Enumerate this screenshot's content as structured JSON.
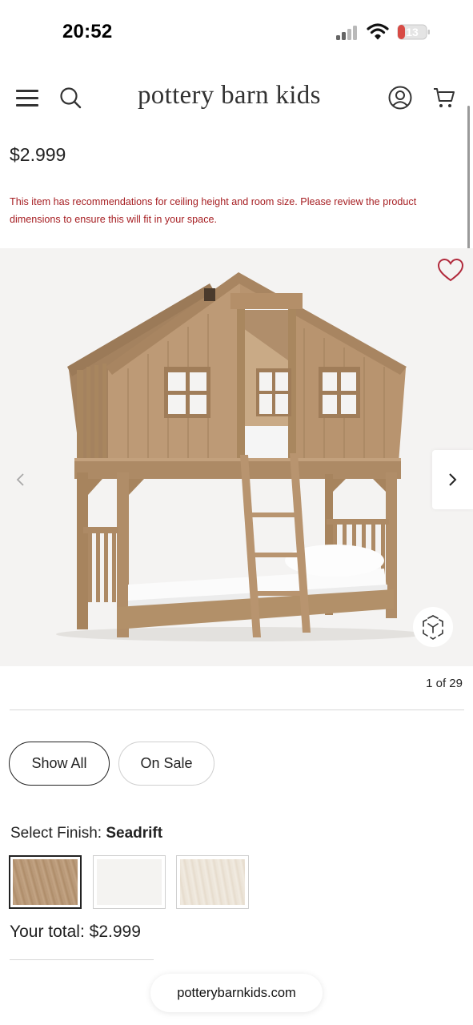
{
  "status_bar": {
    "time": "20:52",
    "battery_level": "13"
  },
  "header": {
    "logo": "pottery barn kids"
  },
  "product": {
    "price": "$2.999",
    "warning": "This item has recommendations for ceiling height and room size. Please review the product dimensions to ensure this will fit in your space.",
    "gallery_counter": "1 of 29"
  },
  "filters": {
    "show_all": "Show All",
    "on_sale": "On Sale"
  },
  "finish": {
    "label": "Select Finish:",
    "selected": "Seadrift",
    "swatches": [
      {
        "name": "seadrift",
        "color": "#b99a78"
      },
      {
        "name": "white",
        "color": "#f4f3f1"
      },
      {
        "name": "whitewash",
        "color": "#ebe3d6"
      }
    ]
  },
  "total": {
    "label": "Your total:",
    "value": "$2.999"
  },
  "browser": {
    "url": "potterybarnkids.com"
  },
  "colors": {
    "warning": "#a61e22",
    "wood": "#b08e6b"
  }
}
